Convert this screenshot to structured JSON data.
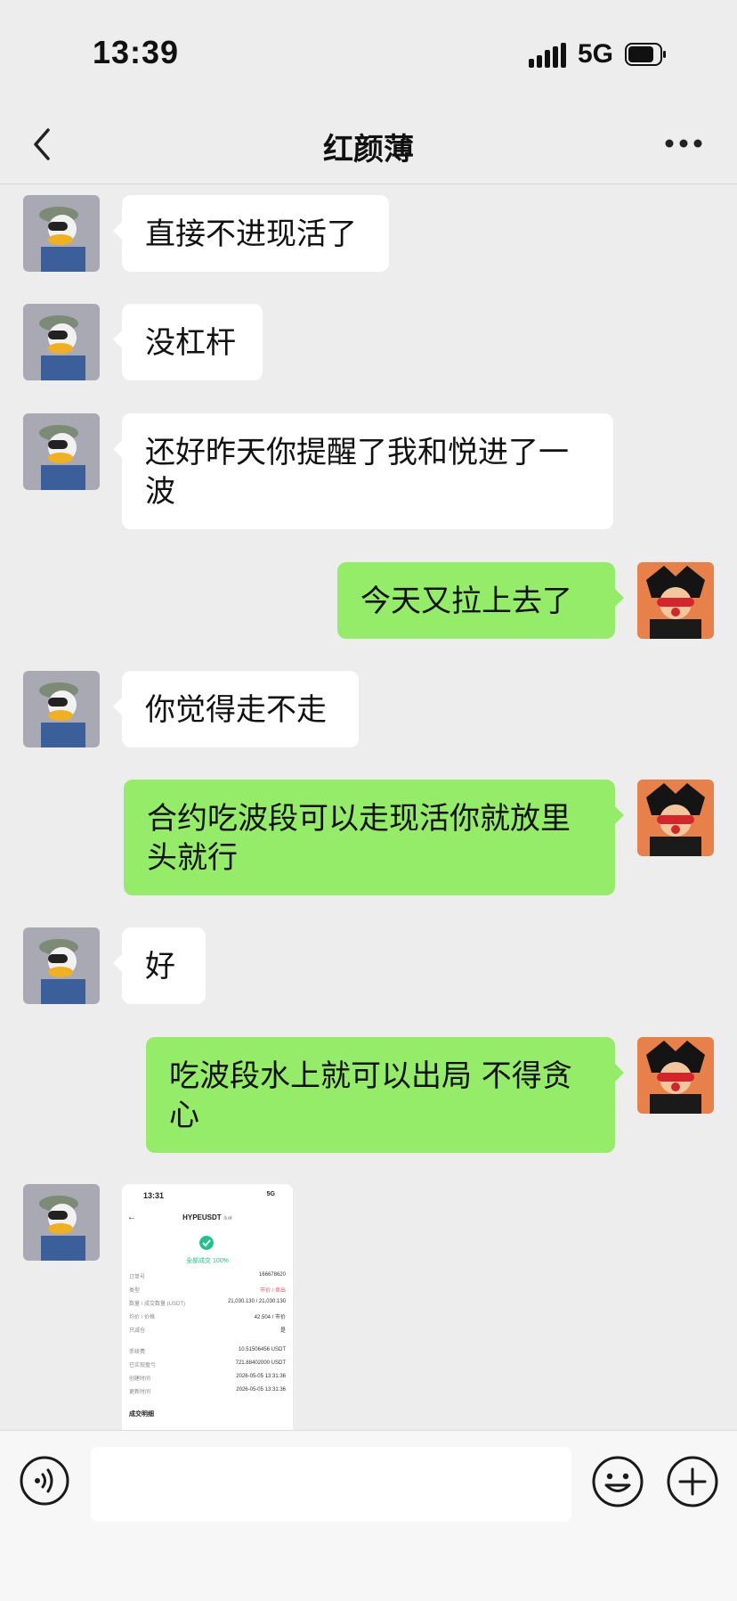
{
  "status_bar": {
    "time": "13:39",
    "network": "5G"
  },
  "header": {
    "title": "红颜薄",
    "back_icon": "chevron-left-icon",
    "more_icon": "ellipsis-icon"
  },
  "messages": [
    {
      "side": "left",
      "text": "直接不进现活了"
    },
    {
      "side": "left",
      "text": "没杠杆"
    },
    {
      "side": "left",
      "text": "还好昨天你提醒了我和悦进了一\n波"
    },
    {
      "side": "right",
      "text": "今天又拉上去了"
    },
    {
      "side": "left",
      "text": "你觉得走不走"
    },
    {
      "side": "right",
      "text": "合约吃波段可以走现活你就放里\n头就行"
    },
    {
      "side": "left",
      "text": "好"
    },
    {
      "side": "right",
      "text": "吃波段水上就可以出局 不得贪\n心"
    },
    {
      "side": "left",
      "type": "image"
    }
  ],
  "screenshot": {
    "time": "13:31",
    "status": "5G",
    "title": "HYPEUSDT",
    "title_tag": "永续",
    "status_text": "全部成交 100%",
    "rows": [
      {
        "label": "订单号",
        "value": "166678620"
      },
      {
        "label": "类型",
        "value": "市价 / 卖出"
      },
      {
        "label": "数量 / 成交数量 (USDT)",
        "value": "21,030.130 / 21,030.130"
      },
      {
        "label": "均价 / 价格",
        "value": "42.504 / 市价"
      },
      {
        "label": "只减仓",
        "value": "是"
      },
      {
        "label": "手续费",
        "value": "10.51506456 USDT"
      },
      {
        "label": "已实现盈亏",
        "value": "721.88402000 USDT"
      },
      {
        "label": "创建时间",
        "value": "2026-05-05 13:31:36"
      },
      {
        "label": "更新时间",
        "value": "2026-05-05 13:31:36"
      }
    ],
    "section": "成交明细"
  },
  "input_bar": {
    "placeholder": "",
    "voice_icon": "voice-icon",
    "emoji_icon": "emoji-icon",
    "plus_icon": "plus-icon"
  },
  "colors": {
    "background": "#ededed",
    "bubble_out": "#95ec69",
    "bubble_in": "#ffffff",
    "accent": "#1ec28b"
  }
}
